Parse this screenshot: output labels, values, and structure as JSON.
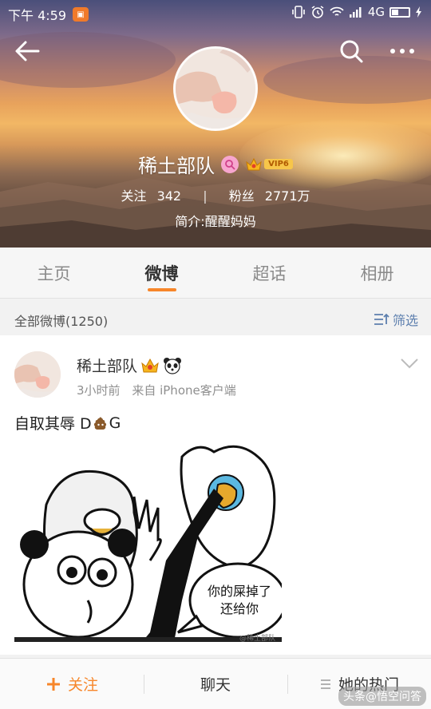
{
  "status_bar": {
    "time": "下午 4:59",
    "network": "4G",
    "icons": [
      "vibrate-icon",
      "alarm-icon",
      "wifi-icon",
      "signal-icon",
      "battery-icon",
      "charging-icon"
    ]
  },
  "header": {
    "back_icon": "back-arrow-icon",
    "search_icon": "search-icon",
    "more_icon": "more-dots-icon"
  },
  "profile": {
    "name": "稀土部队",
    "gender_icon": "female-icon",
    "vip_label": "VIP6",
    "follow_label": "关注",
    "follow_count": "342",
    "divider": "|",
    "fans_label": "粉丝",
    "fans_count": "2771万",
    "bio": "简介:醒醒妈妈"
  },
  "tabs": [
    {
      "label": "主页",
      "active": false
    },
    {
      "label": "微博",
      "active": true
    },
    {
      "label": "超话",
      "active": false
    },
    {
      "label": "相册",
      "active": false
    }
  ],
  "filter": {
    "count_label": "全部微博(1250)",
    "filter_label": "筛选"
  },
  "post": {
    "author": "稀土部队",
    "time": "3小时前",
    "source": "来自 iPhone客户端",
    "text_before": "自取其辱 D",
    "text_after": "G",
    "meme_caption_line1": "你的屎掉了",
    "meme_caption_line2": "还给你",
    "watermark": "@稀土部队"
  },
  "bottom_bar": {
    "follow_label": "关注",
    "chat_label": "聊天",
    "hot_label": "她的热门"
  },
  "corner_logo": "头条@悟空问答",
  "colors": {
    "accent": "#f7862a",
    "link": "#5d7fae"
  }
}
